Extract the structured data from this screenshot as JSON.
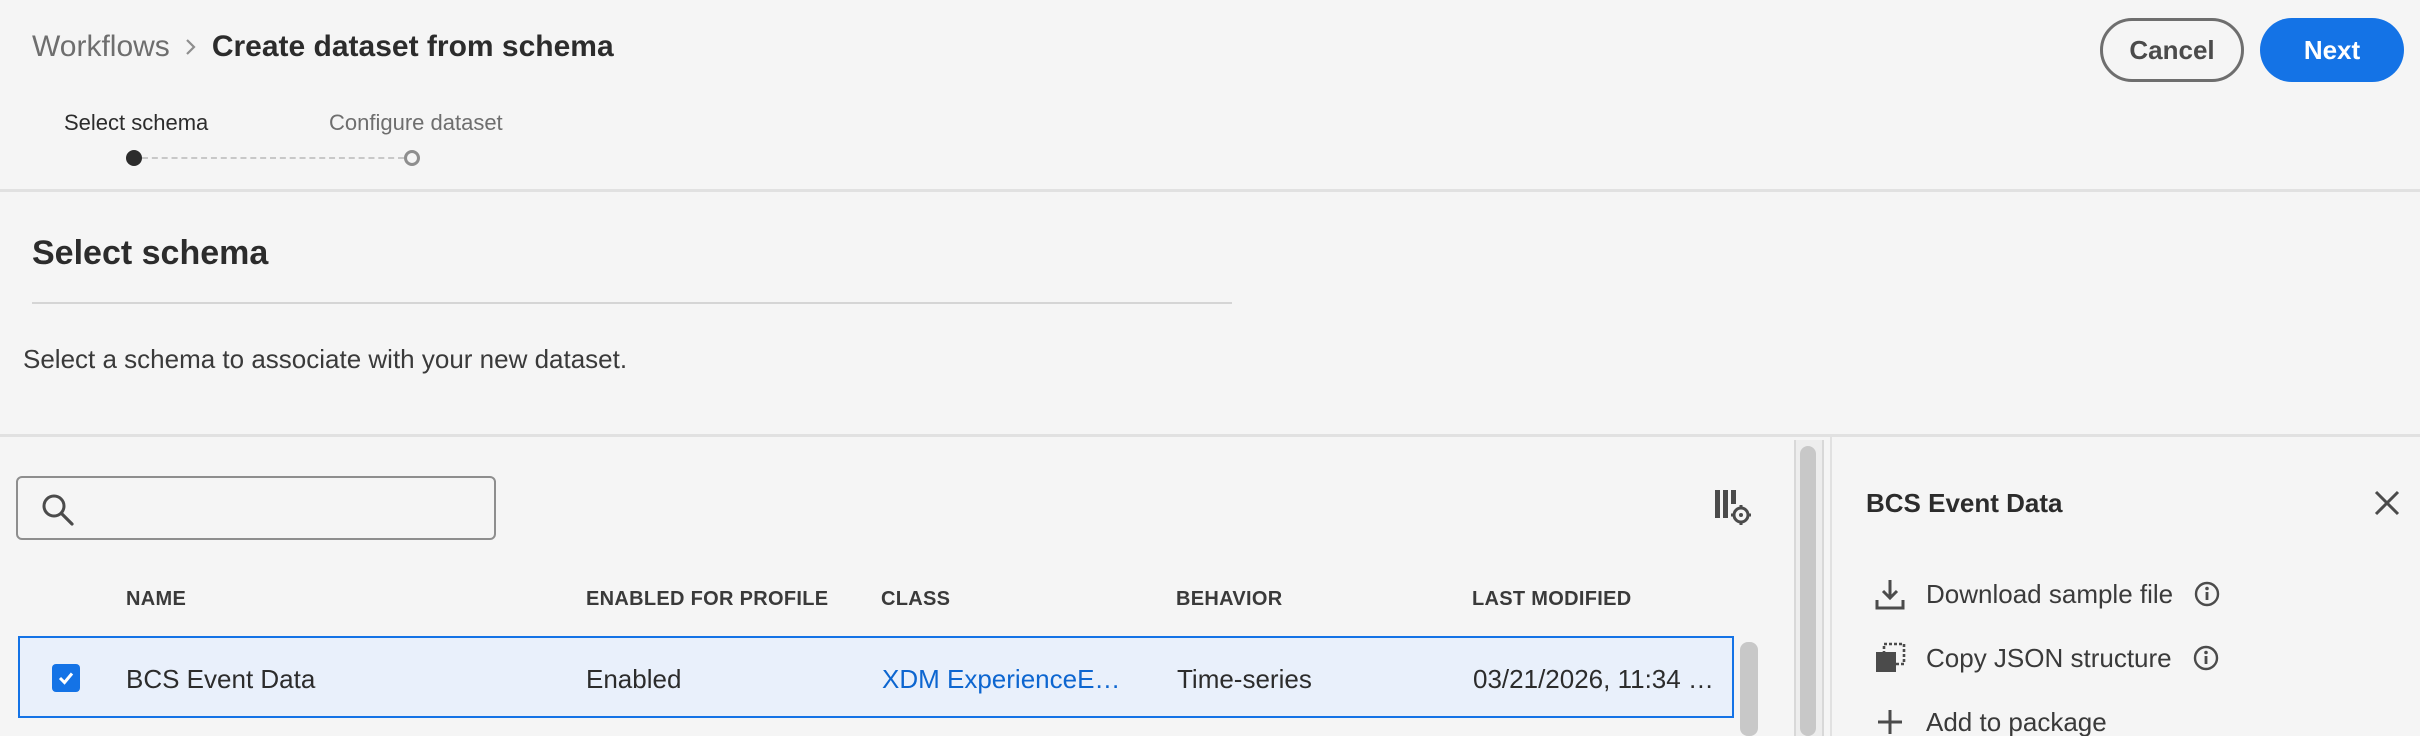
{
  "breadcrumb": {
    "parent": "Workflows",
    "current": "Create dataset from schema"
  },
  "actions": {
    "cancel_label": "Cancel",
    "next_label": "Next"
  },
  "steps": [
    {
      "label": "Select schema",
      "active": true
    },
    {
      "label": "Configure dataset",
      "active": false
    }
  ],
  "section": {
    "title": "Select schema",
    "description": "Select a schema to associate with your new dataset."
  },
  "search": {
    "value": "",
    "placeholder": ""
  },
  "table": {
    "columns": [
      "NAME",
      "ENABLED FOR PROFILE",
      "CLASS",
      "BEHAVIOR",
      "LAST MODIFIED"
    ],
    "rows": [
      {
        "selected": true,
        "name": "BCS Event Data",
        "enabled_for_profile": "Enabled",
        "class": "XDM ExperienceE…",
        "behavior": "Time-series",
        "last_modified": "03/21/2026, 11:34 …"
      }
    ]
  },
  "panel": {
    "title": "BCS Event Data",
    "actions": [
      {
        "label": "Download sample file",
        "icon": "download-icon",
        "info": true
      },
      {
        "label": "Copy JSON structure",
        "icon": "copy-icon",
        "info": true
      },
      {
        "label": "Add to package",
        "icon": "add-icon",
        "info": false
      }
    ]
  },
  "colors": {
    "accent": "#1473e6",
    "link": "#0d66d0",
    "selected_row_bg": "#e9f0fb",
    "background": "#f5f5f5"
  }
}
